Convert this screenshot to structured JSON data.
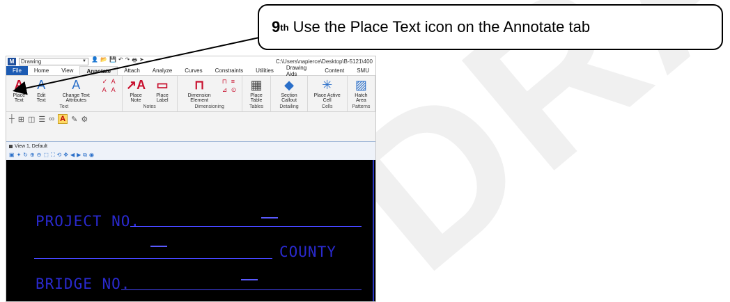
{
  "callout": {
    "step": "9",
    "suffix": "th",
    "text": "Use the Place Text icon on the Annotate tab"
  },
  "watermark": "DRAFT",
  "quick_access": {
    "workspace": "Drawing",
    "path": "C:\\Users\\napierce\\Desktop\\B-5121\\400"
  },
  "tabs": [
    "File",
    "Home",
    "View",
    "Annotate",
    "Attach",
    "Analyze",
    "Curves",
    "Constraints",
    "Utilities",
    "Drawing Aids",
    "Content",
    "SMU"
  ],
  "active_tab": "Annotate",
  "ribbon": {
    "text_group": {
      "title": "Text",
      "place_text": "Place Text",
      "edit_text": "Edit Text",
      "change_text_attributes": "Change Text Attributes"
    },
    "notes_group": {
      "title": "Notes",
      "place_note": "Place Note",
      "place_label": "Place Label"
    },
    "dimensioning_group": {
      "title": "Dimensioning",
      "dimension_element": "Dimension Element"
    },
    "tables_group": {
      "title": "Tables",
      "place_table": "Place Table"
    },
    "detailing_group": {
      "title": "Detailing",
      "section_callout": "Section Callout"
    },
    "cells_group": {
      "title": "Cells",
      "place_active_cell": "Place Active Cell"
    },
    "patterns_group": {
      "title": "Patterns",
      "hatch_area": "Hatch Area"
    }
  },
  "view": {
    "title": "View 1, Default"
  },
  "drawing": {
    "project_no": "PROJECT NO.",
    "county": "COUNTY",
    "bridge_no": "BRIDGE NO.",
    "dash": "-"
  },
  "colors": {
    "file_tab": "#1c5bb3",
    "place_text_icon": "#c8102e",
    "cad_text": "#2a2acf",
    "canvas": "#000000"
  }
}
